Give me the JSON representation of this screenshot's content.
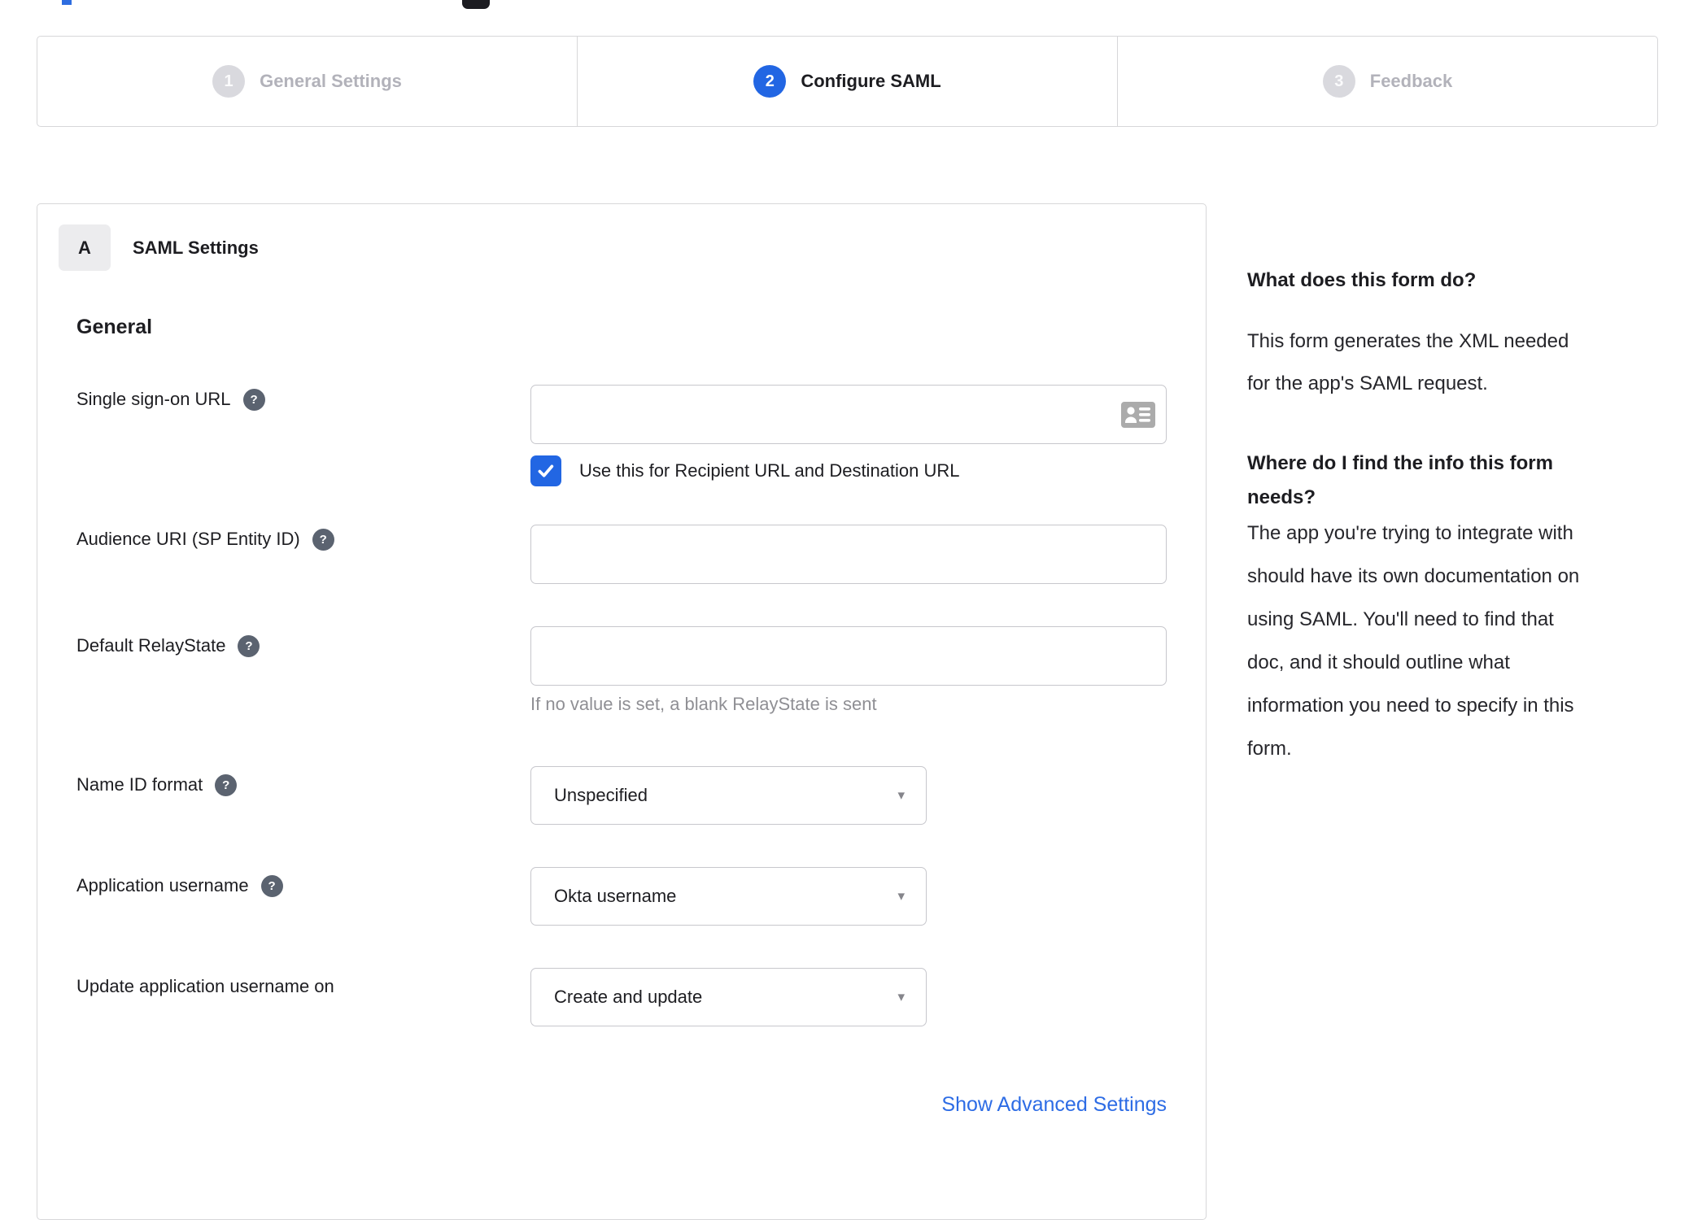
{
  "colors": {
    "accent_blue": "#2266e3",
    "link_blue": "#2d6ce5",
    "text_dark": "#1d1d21",
    "inactive_gray": "#b2b2ba",
    "border_gray": "#d7d7d9",
    "input_border": "#c7c7cc",
    "hint_gray": "#8f8f94",
    "help_icon_bg": "#5b6370",
    "badge_bg": "#ececee",
    "field_icon_gray": "#ababab"
  },
  "icons": {
    "question_mark": "?",
    "caret": "▾"
  },
  "stepper": {
    "steps": [
      {
        "number": "1",
        "label": "General Settings",
        "state": "inactive"
      },
      {
        "number": "2",
        "label": "Configure SAML",
        "state": "active"
      },
      {
        "number": "3",
        "label": "Feedback",
        "state": "inactive"
      }
    ]
  },
  "card": {
    "badge": "A",
    "title": "SAML Settings",
    "section_heading": "General",
    "fields": {
      "sso": {
        "label": "Single sign-on URL",
        "value": "",
        "checkbox_label": "Use this for Recipient URL and Destination URL",
        "checkbox_checked": true
      },
      "audience": {
        "label": "Audience URI (SP Entity ID)",
        "value": ""
      },
      "relay_state": {
        "label": "Default RelayState",
        "value": "",
        "hint": "If no value is set, a blank RelayState is sent"
      },
      "name_id_format": {
        "label": "Name ID format",
        "value": "Unspecified"
      },
      "app_username": {
        "label": "Application username",
        "value": "Okta username"
      },
      "update_username": {
        "label": "Update application username on",
        "value": "Create and update"
      }
    },
    "advanced_link": "Show Advanced Settings"
  },
  "sidebar": {
    "heading_1": "What does this form do?",
    "paragraph_1_lines": [
      "This form generates the XML needed",
      "for the app's SAML request."
    ],
    "heading_2_lines": [
      "Where do I find the info this form",
      "needs?"
    ],
    "paragraph_2_lines": [
      "The app you're trying to integrate with",
      "should have its own documentation on",
      "using SAML. You'll need to find that",
      "doc, and it should outline what",
      "information you need to specify in this",
      "form."
    ]
  }
}
